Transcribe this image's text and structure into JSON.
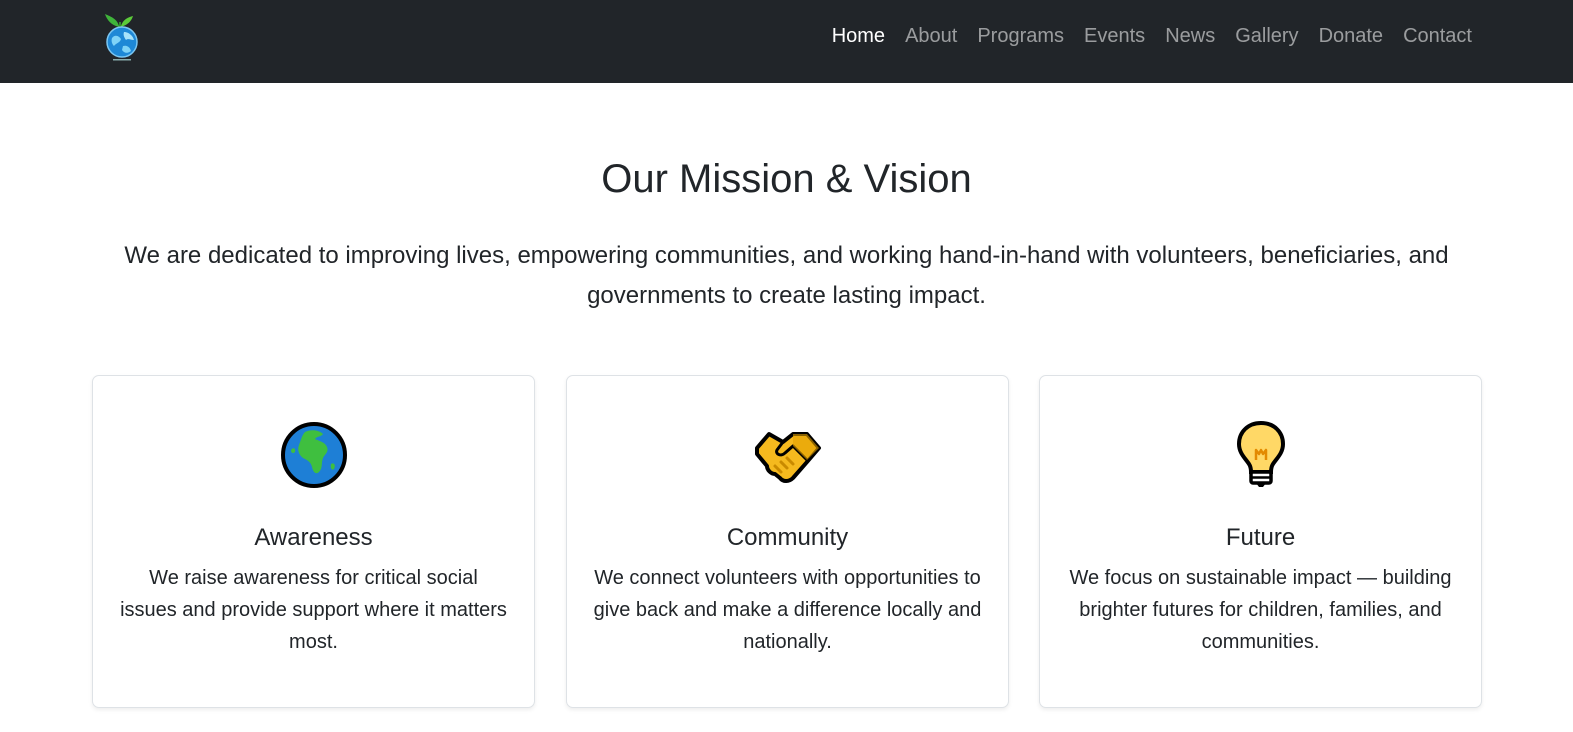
{
  "nav": {
    "logo_icon": "globe-with-sprout-icon",
    "links": [
      {
        "label": "Home",
        "active": true
      },
      {
        "label": "About"
      },
      {
        "label": "Programs"
      },
      {
        "label": "Events"
      },
      {
        "label": "News"
      },
      {
        "label": "Gallery"
      },
      {
        "label": "Donate"
      },
      {
        "label": "Contact"
      }
    ]
  },
  "mission": {
    "title": "Our Mission & Vision",
    "lead": "We are dedicated to improving lives, empowering communities, and working hand-in-hand with volunteers, beneficiaries, and governments to create lasting impact."
  },
  "cards": [
    {
      "icon": "globe-africa-icon",
      "title": "Awareness",
      "text": "We raise awareness for critical social issues and provide support where it matters most."
    },
    {
      "icon": "handshake-icon",
      "title": "Community",
      "text": "We connect volunteers with opportunities to give back and make a difference locally and nationally."
    },
    {
      "icon": "light-bulb-icon",
      "title": "Future",
      "text": "We focus on sustainable impact — building brighter futures for children, families, and communities."
    }
  ],
  "colors": {
    "navbar_bg": "#212529",
    "nav_active": "#ffffff",
    "nav_inactive": "rgba(255,255,255,0.55)",
    "text": "#212529",
    "card_border": "#dee2e6"
  }
}
